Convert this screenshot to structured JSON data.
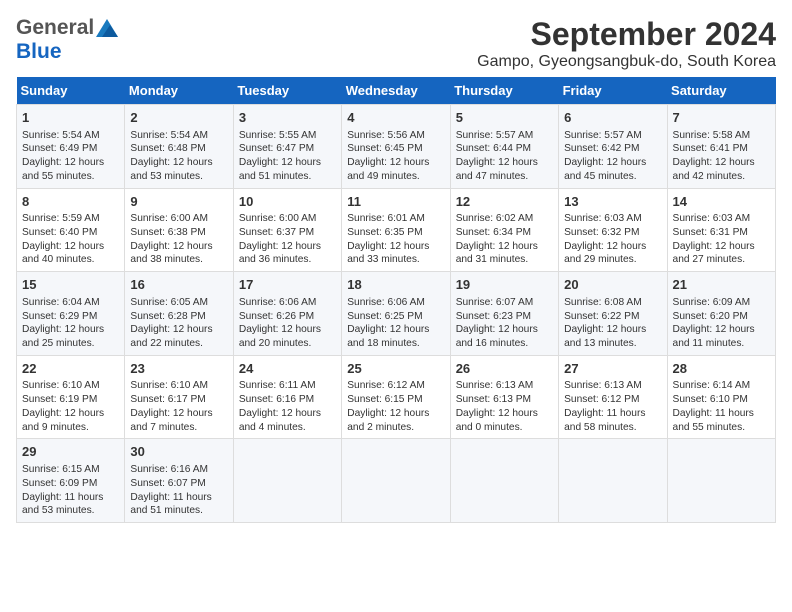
{
  "header": {
    "logo_general": "General",
    "logo_blue": "Blue",
    "month": "September 2024",
    "location": "Gampo, Gyeongsangbuk-do, South Korea"
  },
  "days_of_week": [
    "Sunday",
    "Monday",
    "Tuesday",
    "Wednesday",
    "Thursday",
    "Friday",
    "Saturday"
  ],
  "weeks": [
    [
      {
        "day": "1",
        "info": "Sunrise: 5:54 AM\nSunset: 6:49 PM\nDaylight: 12 hours\nand 55 minutes."
      },
      {
        "day": "2",
        "info": "Sunrise: 5:54 AM\nSunset: 6:48 PM\nDaylight: 12 hours\nand 53 minutes."
      },
      {
        "day": "3",
        "info": "Sunrise: 5:55 AM\nSunset: 6:47 PM\nDaylight: 12 hours\nand 51 minutes."
      },
      {
        "day": "4",
        "info": "Sunrise: 5:56 AM\nSunset: 6:45 PM\nDaylight: 12 hours\nand 49 minutes."
      },
      {
        "day": "5",
        "info": "Sunrise: 5:57 AM\nSunset: 6:44 PM\nDaylight: 12 hours\nand 47 minutes."
      },
      {
        "day": "6",
        "info": "Sunrise: 5:57 AM\nSunset: 6:42 PM\nDaylight: 12 hours\nand 45 minutes."
      },
      {
        "day": "7",
        "info": "Sunrise: 5:58 AM\nSunset: 6:41 PM\nDaylight: 12 hours\nand 42 minutes."
      }
    ],
    [
      {
        "day": "8",
        "info": "Sunrise: 5:59 AM\nSunset: 6:40 PM\nDaylight: 12 hours\nand 40 minutes."
      },
      {
        "day": "9",
        "info": "Sunrise: 6:00 AM\nSunset: 6:38 PM\nDaylight: 12 hours\nand 38 minutes."
      },
      {
        "day": "10",
        "info": "Sunrise: 6:00 AM\nSunset: 6:37 PM\nDaylight: 12 hours\nand 36 minutes."
      },
      {
        "day": "11",
        "info": "Sunrise: 6:01 AM\nSunset: 6:35 PM\nDaylight: 12 hours\nand 33 minutes."
      },
      {
        "day": "12",
        "info": "Sunrise: 6:02 AM\nSunset: 6:34 PM\nDaylight: 12 hours\nand 31 minutes."
      },
      {
        "day": "13",
        "info": "Sunrise: 6:03 AM\nSunset: 6:32 PM\nDaylight: 12 hours\nand 29 minutes."
      },
      {
        "day": "14",
        "info": "Sunrise: 6:03 AM\nSunset: 6:31 PM\nDaylight: 12 hours\nand 27 minutes."
      }
    ],
    [
      {
        "day": "15",
        "info": "Sunrise: 6:04 AM\nSunset: 6:29 PM\nDaylight: 12 hours\nand 25 minutes."
      },
      {
        "day": "16",
        "info": "Sunrise: 6:05 AM\nSunset: 6:28 PM\nDaylight: 12 hours\nand 22 minutes."
      },
      {
        "day": "17",
        "info": "Sunrise: 6:06 AM\nSunset: 6:26 PM\nDaylight: 12 hours\nand 20 minutes."
      },
      {
        "day": "18",
        "info": "Sunrise: 6:06 AM\nSunset: 6:25 PM\nDaylight: 12 hours\nand 18 minutes."
      },
      {
        "day": "19",
        "info": "Sunrise: 6:07 AM\nSunset: 6:23 PM\nDaylight: 12 hours\nand 16 minutes."
      },
      {
        "day": "20",
        "info": "Sunrise: 6:08 AM\nSunset: 6:22 PM\nDaylight: 12 hours\nand 13 minutes."
      },
      {
        "day": "21",
        "info": "Sunrise: 6:09 AM\nSunset: 6:20 PM\nDaylight: 12 hours\nand 11 minutes."
      }
    ],
    [
      {
        "day": "22",
        "info": "Sunrise: 6:10 AM\nSunset: 6:19 PM\nDaylight: 12 hours\nand 9 minutes."
      },
      {
        "day": "23",
        "info": "Sunrise: 6:10 AM\nSunset: 6:17 PM\nDaylight: 12 hours\nand 7 minutes."
      },
      {
        "day": "24",
        "info": "Sunrise: 6:11 AM\nSunset: 6:16 PM\nDaylight: 12 hours\nand 4 minutes."
      },
      {
        "day": "25",
        "info": "Sunrise: 6:12 AM\nSunset: 6:15 PM\nDaylight: 12 hours\nand 2 minutes."
      },
      {
        "day": "26",
        "info": "Sunrise: 6:13 AM\nSunset: 6:13 PM\nDaylight: 12 hours\nand 0 minutes."
      },
      {
        "day": "27",
        "info": "Sunrise: 6:13 AM\nSunset: 6:12 PM\nDaylight: 11 hours\nand 58 minutes."
      },
      {
        "day": "28",
        "info": "Sunrise: 6:14 AM\nSunset: 6:10 PM\nDaylight: 11 hours\nand 55 minutes."
      }
    ],
    [
      {
        "day": "29",
        "info": "Sunrise: 6:15 AM\nSunset: 6:09 PM\nDaylight: 11 hours\nand 53 minutes."
      },
      {
        "day": "30",
        "info": "Sunrise: 6:16 AM\nSunset: 6:07 PM\nDaylight: 11 hours\nand 51 minutes."
      },
      {
        "day": "",
        "info": ""
      },
      {
        "day": "",
        "info": ""
      },
      {
        "day": "",
        "info": ""
      },
      {
        "day": "",
        "info": ""
      },
      {
        "day": "",
        "info": ""
      }
    ]
  ]
}
